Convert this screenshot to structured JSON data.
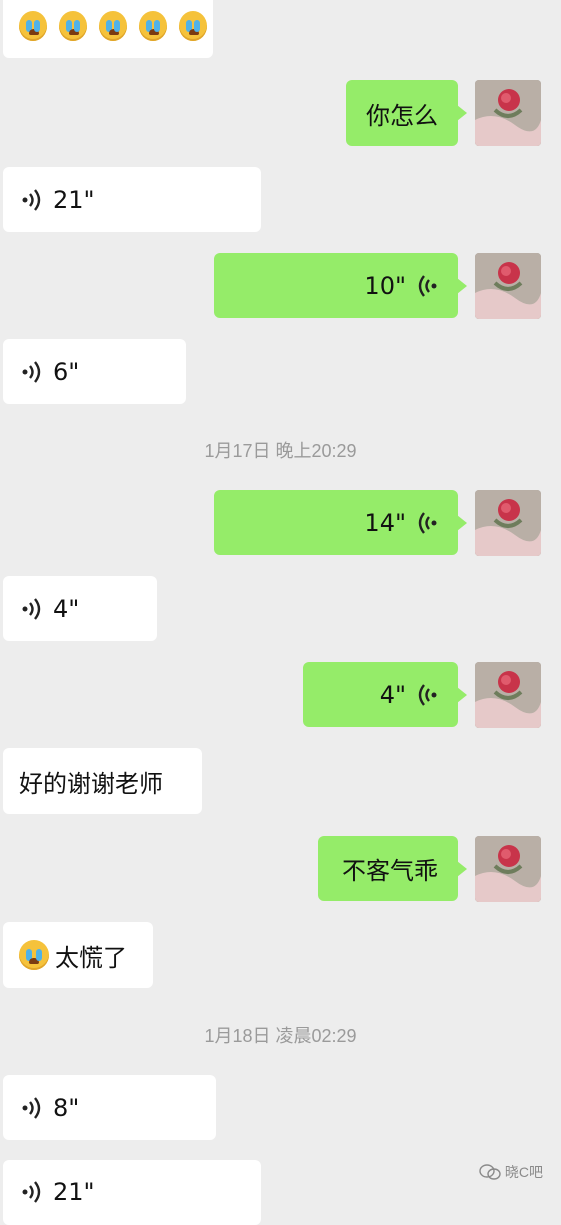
{
  "chat": {
    "messages": [
      {
        "side": "in",
        "type": "emoji",
        "count": 5,
        "text": ""
      },
      {
        "side": "out",
        "type": "text",
        "text": "你怎么"
      },
      {
        "side": "in",
        "type": "voice",
        "duration": "21\""
      },
      {
        "side": "out",
        "type": "voice",
        "duration": "10\""
      },
      {
        "side": "in",
        "type": "voice",
        "duration": "6\""
      },
      {
        "type": "timestamp",
        "text": "1月17日 晚上20:29"
      },
      {
        "side": "out",
        "type": "voice",
        "duration": "14\""
      },
      {
        "side": "in",
        "type": "voice",
        "duration": "4\""
      },
      {
        "side": "out",
        "type": "voice",
        "duration": "4\""
      },
      {
        "side": "in",
        "type": "text",
        "text": "好的谢谢老师"
      },
      {
        "side": "out",
        "type": "text",
        "text": "不客气乖"
      },
      {
        "side": "in",
        "type": "emoji-text",
        "text": "太慌了"
      },
      {
        "type": "timestamp",
        "text": "1月18日 凌晨02:29"
      },
      {
        "side": "in",
        "type": "voice",
        "duration": "8\""
      },
      {
        "side": "in",
        "type": "voice",
        "duration": "21\""
      }
    ]
  },
  "watermark": {
    "text": "晓C吧"
  },
  "colors": {
    "background": "#ededed",
    "outgoing": "#95ec69",
    "incoming": "#ffffff"
  },
  "icons": {
    "emoji": "crying-face-icon",
    "voice": "voice-wave-icon",
    "avatar": "rose-avatar"
  }
}
